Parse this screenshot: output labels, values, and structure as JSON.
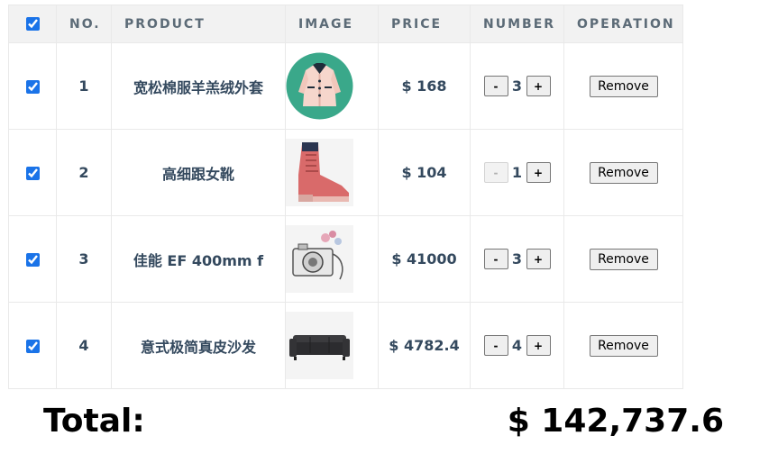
{
  "table": {
    "headers": {
      "select_all_checked": true,
      "no": "NO.",
      "product": "PRODUCT",
      "image": "IMAGE",
      "price": "PRICE",
      "number": "NUMBER",
      "operation": "OPERATION"
    },
    "rows": [
      {
        "no": "1",
        "product": "宽松棉服羊羔绒外套",
        "price": "$ 168",
        "quantity": "3",
        "decrement": "-",
        "increment": "+",
        "remove": "Remove",
        "checked": true,
        "decrement_disabled": false,
        "image_icon": "jacket-image"
      },
      {
        "no": "2",
        "product": "高细跟女靴",
        "price": "$ 104",
        "quantity": "1",
        "decrement": "-",
        "increment": "+",
        "remove": "Remove",
        "checked": true,
        "decrement_disabled": true,
        "image_icon": "boot-image"
      },
      {
        "no": "3",
        "product": "佳能 EF 400mm f",
        "price": "$ 41000",
        "quantity": "3",
        "decrement": "-",
        "increment": "+",
        "remove": "Remove",
        "checked": true,
        "decrement_disabled": false,
        "image_icon": "camera-image"
      },
      {
        "no": "4",
        "product": "意式极简真皮沙发",
        "price": "$ 4782.4",
        "quantity": "4",
        "decrement": "-",
        "increment": "+",
        "remove": "Remove",
        "checked": true,
        "decrement_disabled": false,
        "image_icon": "sofa-image"
      }
    ]
  },
  "summary": {
    "total_label": "Total:",
    "total_value": "$ 142,737.6"
  },
  "colors": {
    "text": "#34495e",
    "header_bg": "#f2f2f2",
    "border": "#e9e9e9",
    "checkbox": "#1a73e8",
    "jacket_bg": "#3aa88a"
  }
}
